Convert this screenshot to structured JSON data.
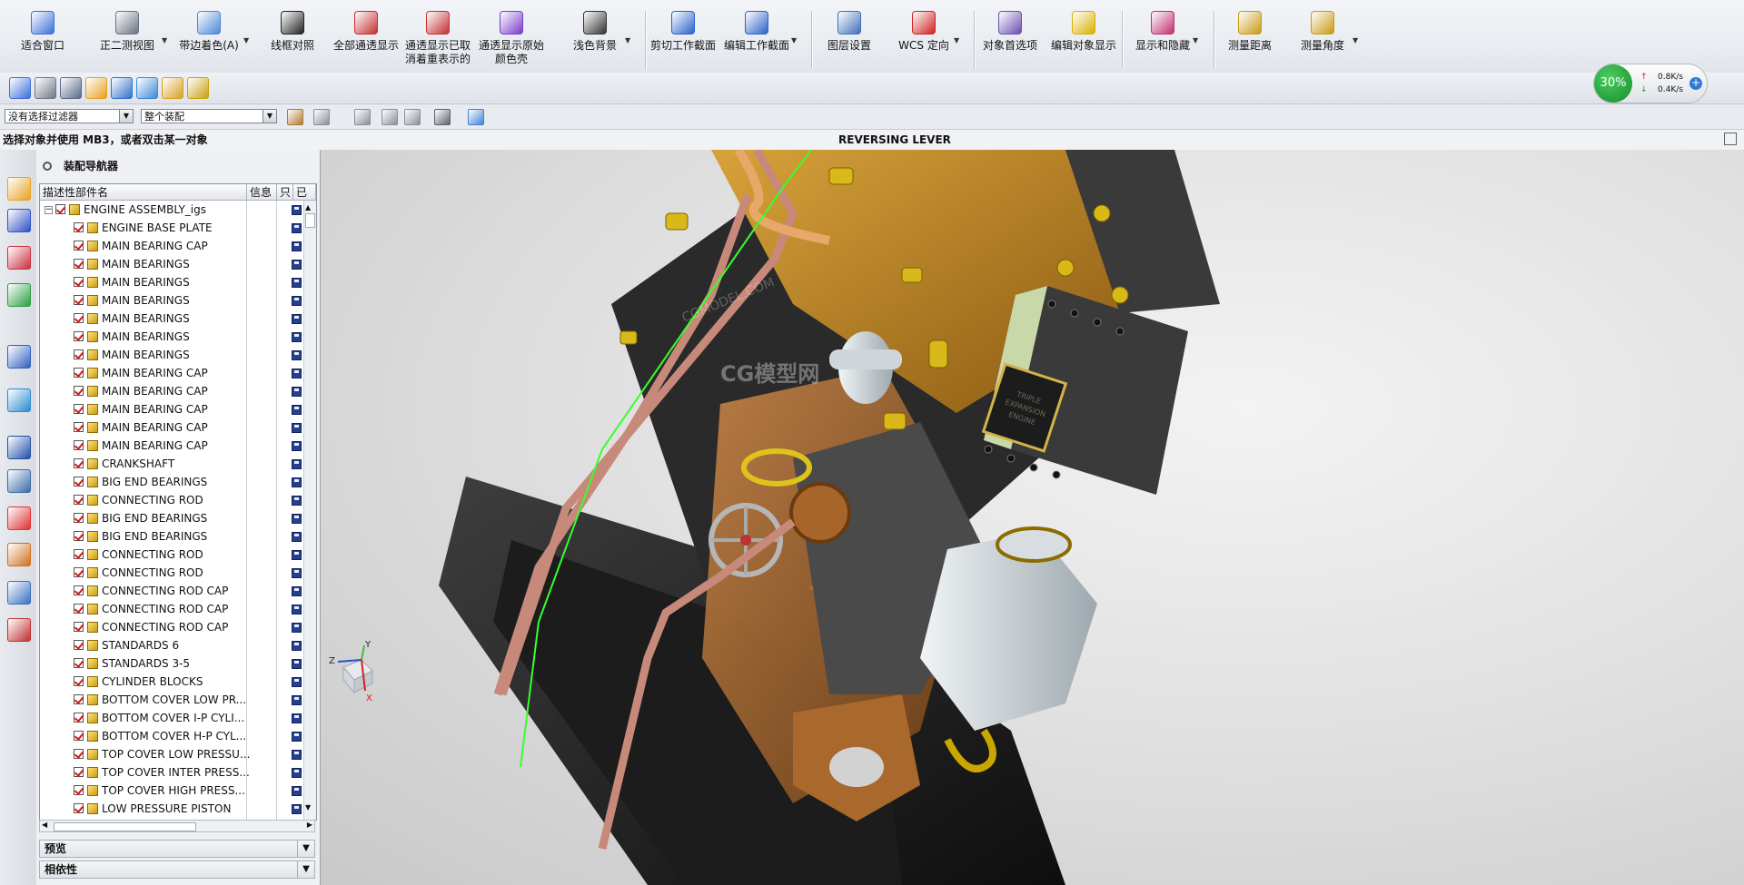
{
  "ribbon": {
    "buttons": [
      {
        "label": "适合窗口",
        "icon": "fit-window-icon",
        "color": "#3a6fd8"
      },
      {
        "label": "正二测视图",
        "icon": "view-orient-icon",
        "color": "#6a7280"
      },
      {
        "label": "带边着色(A)",
        "icon": "shaded-edges-icon",
        "color": "#4c88d8"
      },
      {
        "label": "线框对照",
        "icon": "wireframe-icon",
        "color": "#222222"
      },
      {
        "label": "全部通透显示",
        "icon": "translucent-all-icon",
        "color": "#c23030"
      },
      {
        "label": "通透显示已取消着重表示的",
        "icon": "translucent-deemphasis-icon",
        "color": "#c23030"
      },
      {
        "label": "通透显示原始颜色壳",
        "icon": "translucent-color-icon",
        "color": "#7a3cc9"
      },
      {
        "label": "浅色背景",
        "icon": "light-background-icon",
        "color": "#333333"
      },
      {
        "label": "剪切工作截面",
        "icon": "clip-section-icon",
        "color": "#2a62c8"
      },
      {
        "label": "编辑工作截面",
        "icon": "edit-section-icon",
        "color": "#2a62c8"
      },
      {
        "label": "图层设置",
        "icon": "layer-settings-icon",
        "color": "#4070b8"
      },
      {
        "label": "WCS 定向",
        "icon": "wcs-orient-icon",
        "color": "#d02020"
      },
      {
        "label": "对象首选项",
        "icon": "object-preferences-icon",
        "color": "#6a4fb0"
      },
      {
        "label": "编辑对象显示",
        "icon": "edit-object-display-icon",
        "color": "#d8b000"
      },
      {
        "label": "显示和隐藏",
        "icon": "show-hide-icon",
        "color": "#c02e70"
      },
      {
        "label": "测量距离",
        "icon": "measure-distance-icon",
        "color": "#c89a10"
      },
      {
        "label": "测量角度",
        "icon": "measure-angle-icon",
        "color": "#c89a10"
      }
    ]
  },
  "filterbar": {
    "selection_filter": "没有选择过滤器",
    "scope": "整个装配"
  },
  "status": {
    "prompt": "选择对象并使用 MB3，或者双击某一对象",
    "title": "REVERSING LEVER"
  },
  "network": {
    "percent": "30%",
    "up": "0.8K/s",
    "down": "0.4K/s"
  },
  "navigator": {
    "title": "装配导航器",
    "columns": [
      "描述性部件名",
      "信息",
      "只",
      "已"
    ],
    "root": "ENGINE ASSEMBLY_igs",
    "items": [
      "ENGINE BASE PLATE",
      "MAIN BEARING CAP",
      "MAIN BEARINGS",
      "MAIN BEARINGS",
      "MAIN BEARINGS",
      "MAIN BEARINGS",
      "MAIN BEARINGS",
      "MAIN BEARINGS",
      "MAIN BEARING CAP",
      "MAIN BEARING CAP",
      "MAIN BEARING CAP",
      "MAIN BEARING CAP",
      "MAIN BEARING CAP",
      "CRANKSHAFT",
      "BIG END BEARINGS",
      "CONNECTING ROD",
      "BIG END BEARINGS",
      "BIG END BEARINGS",
      "CONNECTING ROD",
      "CONNECTING ROD",
      "CONNECTING ROD CAP",
      "CONNECTING ROD CAP",
      "CONNECTING ROD CAP",
      "STANDARDS 6",
      "STANDARDS 3-5",
      "CYLINDER BLOCKS",
      "BOTTOM COVER LOW PR...",
      "BOTTOM COVER I-P CYLI...",
      "BOTTOM COVER H-P CYL...",
      "TOP COVER LOW PRESSU...",
      "TOP COVER INTER PRESS...",
      "TOP COVER HIGH PRESS...",
      "LOW PRESSURE PISTON"
    ],
    "panels": [
      "预览",
      "相依性"
    ]
  },
  "view": {
    "axes": {
      "x": "X",
      "y": "Y",
      "z": "Z"
    },
    "nameplate": [
      "TRIPLE",
      "EXPANSION",
      "ENGINE"
    ],
    "watermark": [
      "CGMODEL.COM",
      "CG模型网"
    ]
  }
}
